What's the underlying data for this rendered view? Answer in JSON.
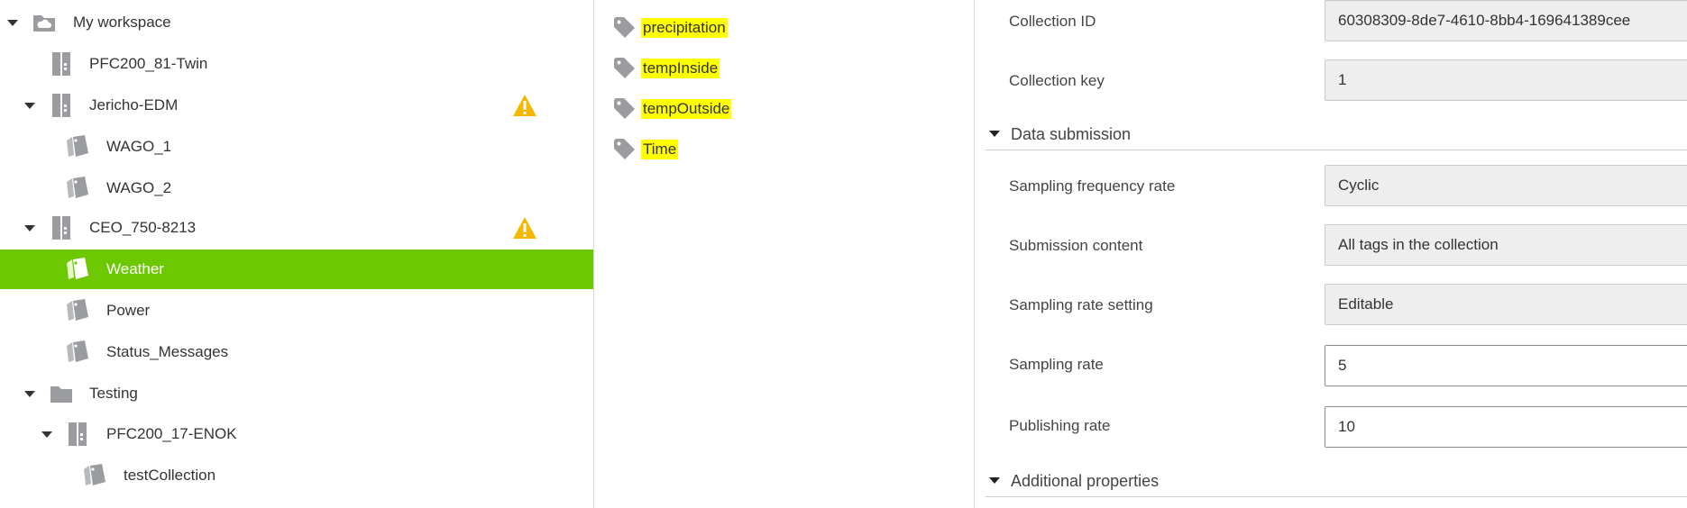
{
  "tree": {
    "items": [
      {
        "label": "My workspace",
        "icon": "cloud-folder-icon",
        "expanded": true,
        "warning": false
      },
      {
        "label": "PFC200_81-Twin",
        "icon": "controller-icon",
        "expanded": false,
        "warning": false
      },
      {
        "label": "Jericho-EDM",
        "icon": "controller-icon",
        "expanded": true,
        "warning": true
      },
      {
        "label": "WAGO_1",
        "icon": "collection-tag-icon",
        "expanded": false,
        "warning": false
      },
      {
        "label": "WAGO_2",
        "icon": "collection-tag-icon",
        "expanded": false,
        "warning": false
      },
      {
        "label": "CEO_750-8213",
        "icon": "controller-icon",
        "expanded": true,
        "warning": true
      },
      {
        "label": "Weather",
        "icon": "collection-tag-icon",
        "expanded": false,
        "warning": false,
        "selected": true
      },
      {
        "label": "Power",
        "icon": "collection-tag-icon",
        "expanded": false,
        "warning": false
      },
      {
        "label": "Status_Messages",
        "icon": "collection-tag-icon",
        "expanded": false,
        "warning": false
      },
      {
        "label": "Testing",
        "icon": "folder-icon",
        "expanded": true,
        "warning": false
      },
      {
        "label": "PFC200_17-ENOK",
        "icon": "controller-icon",
        "expanded": true,
        "warning": false
      },
      {
        "label": "testCollection",
        "icon": "collection-tag-icon",
        "expanded": false,
        "warning": false
      }
    ]
  },
  "tags": {
    "items": [
      {
        "label": "precipitation",
        "icon": "tag-icon"
      },
      {
        "label": "tempInside",
        "icon": "tag-icon"
      },
      {
        "label": "tempOutside",
        "icon": "tag-icon"
      },
      {
        "label": "Time",
        "icon": "tag-icon"
      }
    ]
  },
  "properties": {
    "collection_id": {
      "label": "Collection ID",
      "value": "60308309-8de7-4610-8bb4-169641389cee"
    },
    "collection_key": {
      "label": "Collection key",
      "value": "1"
    },
    "data_submission": {
      "title": "Data submission"
    },
    "sampling_frequency_rate": {
      "label": "Sampling frequency rate",
      "value": "Cyclic"
    },
    "submission_content": {
      "label": "Submission content",
      "value": "All tags in the collection"
    },
    "sampling_rate_setting": {
      "label": "Sampling rate setting",
      "value": "Editable"
    },
    "sampling_rate": {
      "label": "Sampling rate",
      "value": "5"
    },
    "publishing_rate": {
      "label": "Publishing rate",
      "value": "10"
    },
    "additional_properties": {
      "title": "Additional properties"
    }
  },
  "colors": {
    "selected_row": "#6cc800",
    "tag_highlight": "#ffff00",
    "warning": "#f5b800",
    "icon_gray": "#9a9ca0"
  }
}
